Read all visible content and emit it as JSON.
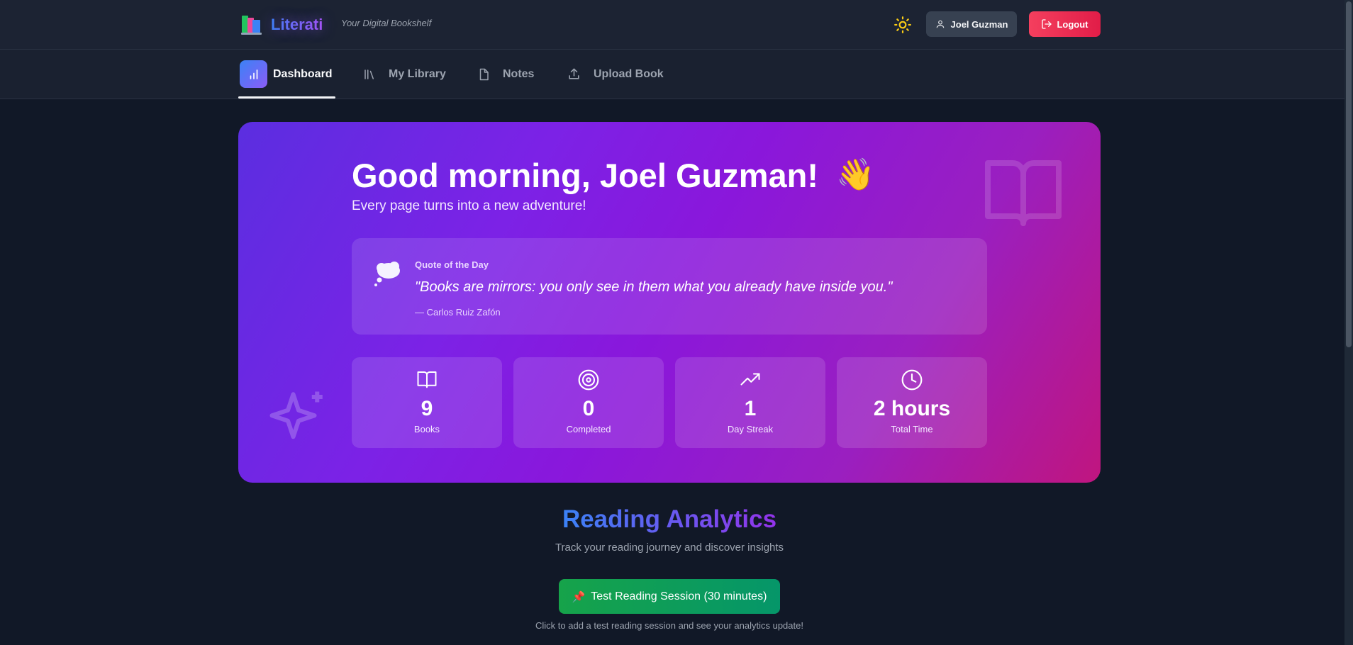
{
  "header": {
    "app_name": "Literati",
    "tagline": "Your Digital Bookshelf",
    "user_name": "Joel Guzman",
    "logout_label": "Logout"
  },
  "nav": {
    "items": [
      {
        "label": "Dashboard",
        "icon": "bar-chart-icon",
        "active": true
      },
      {
        "label": "My Library",
        "icon": "library-icon"
      },
      {
        "label": "Notes",
        "icon": "file-icon"
      },
      {
        "label": "Upload Book",
        "icon": "upload-icon"
      }
    ]
  },
  "hero": {
    "greeting": "Good morning, Joel Guzman!",
    "wave_emoji": "👋",
    "subtitle": "Every page turns into a new adventure!",
    "quote": {
      "label": "Quote of the Day",
      "text": "\"Books are mirrors: you only see in them what you already have inside you.\"",
      "author": "— Carlos Ruiz Zafón",
      "icon": "thought-bubble-icon"
    },
    "stats": [
      {
        "value": "9",
        "label": "Books",
        "icon": "open-book-icon"
      },
      {
        "value": "0",
        "label": "Completed",
        "icon": "target-icon"
      },
      {
        "value": "1",
        "label": "Day Streak",
        "icon": "trending-up-icon"
      },
      {
        "value": "2 hours",
        "label": "Total Time",
        "icon": "clock-icon"
      }
    ]
  },
  "analytics": {
    "title": "Reading Analytics",
    "subtitle": "Track your reading journey and discover insights",
    "test_button": "Test Reading Session (30 minutes)",
    "test_button_emoji": "📌",
    "hint": "Click to add a test reading session and see your analytics update!"
  },
  "colors": {
    "background": "#111827",
    "logout": "#f43f5e",
    "test_button": "#16a34a",
    "accent_blue": "#3b82f6",
    "accent_purple": "#9333ea"
  }
}
